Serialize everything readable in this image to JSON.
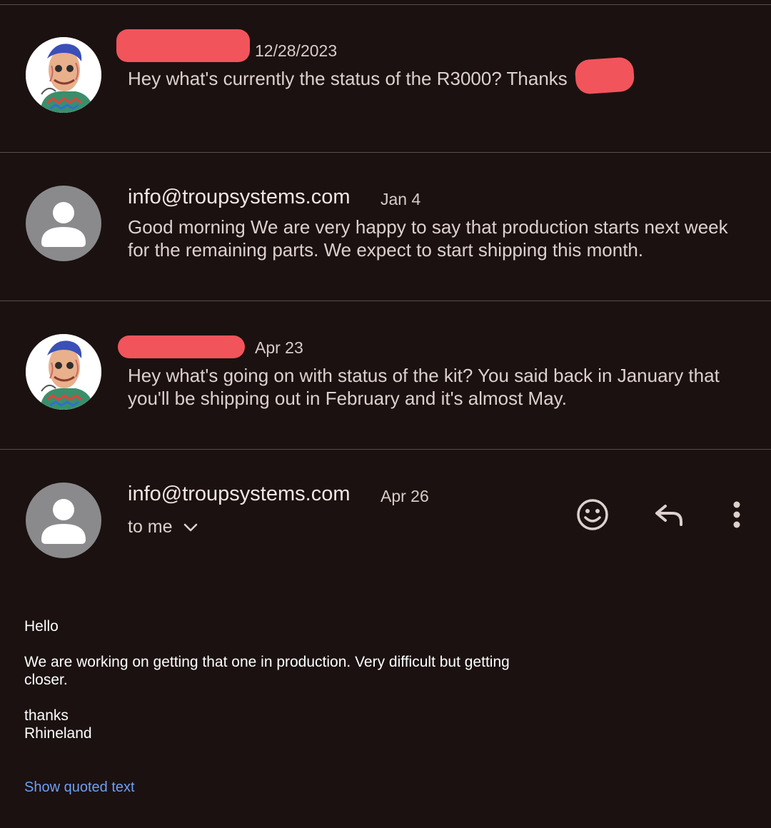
{
  "messages": [
    {
      "sender": "",
      "date": "12/28/2023",
      "snippet": "Hey what's currently the status of the R3000? Thanks",
      "avatar": "cartoon-portrait-avatar"
    },
    {
      "sender": "info@troupsystems.com",
      "date": "Jan 4",
      "snippet": "Good morning We are very happy to say that production starts next week for the remaining parts. We expect to start shipping this month.",
      "avatar": "person-icon"
    },
    {
      "sender": "",
      "date": "Apr 23",
      "snippet": "Hey what's going on with status of the kit? You said back in January that you'll be shipping out in February and it's almost May.",
      "avatar": "cartoon-portrait-avatar"
    }
  ],
  "open_message": {
    "sender": "info@troupsystems.com",
    "date": "Apr 26",
    "recipient_label": "to me",
    "actions": [
      "smiley-icon",
      "reply-icon",
      "more-vertical-icon"
    ],
    "body": {
      "greeting": "Hello",
      "paragraph": "We are working on getting that one in production. Very difficult but getting closer.",
      "signoff": "thanks",
      "signature": "Rhineland"
    },
    "show_quoted_label": "Show quoted text"
  },
  "colors": {
    "background": "#1b1111",
    "divider": "#5a4e4c",
    "link": "#6f9ff2",
    "redaction": "#f2545b"
  }
}
